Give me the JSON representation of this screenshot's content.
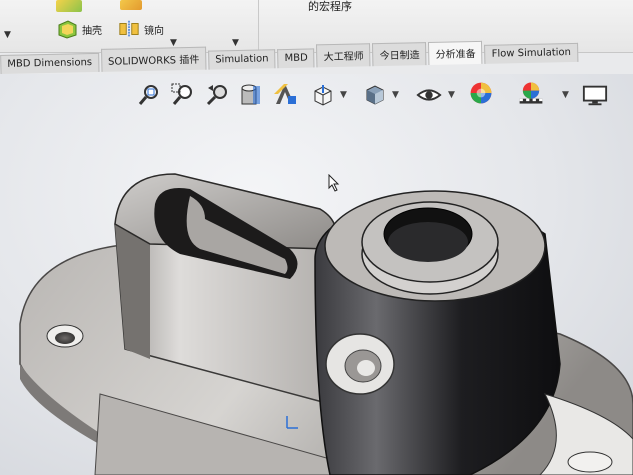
{
  "ribbon": {
    "shell_label": "抽壳",
    "mirror_label": "镜向",
    "sequence_label": "的宏程序"
  },
  "tabs": [
    {
      "label": "MBD Dimensions"
    },
    {
      "label": "SOLIDWORKS 插件"
    },
    {
      "label": "Simulation"
    },
    {
      "label": "MBD"
    },
    {
      "label": "大工程师"
    },
    {
      "label": "今日制造"
    },
    {
      "label": "分析准备"
    },
    {
      "label": "Flow Simulation"
    }
  ],
  "view_toolbar": {
    "icons": [
      "zoom-to-fit-icon",
      "zoom-area-icon",
      "previous-view-icon",
      "section-view-icon",
      "dynamic-annotation-icon",
      "view-orientation-icon",
      "display-style-icon",
      "hide-show-icon",
      "edit-appearance-icon",
      "apply-scene-icon",
      "view-settings-icon"
    ]
  },
  "colors": {
    "accent": "#2b6fd6",
    "part_light": "#c9c7c5",
    "part_dark": "#1f1f22"
  }
}
